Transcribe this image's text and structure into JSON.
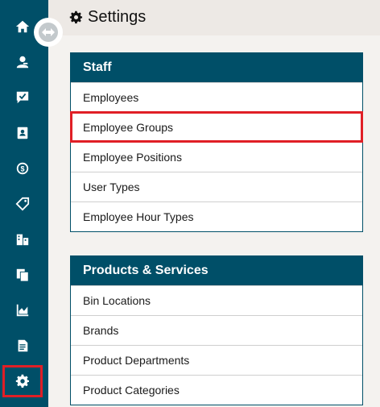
{
  "header": {
    "title": "Settings",
    "icon": "gear-icon"
  },
  "sidebar": {
    "items": [
      {
        "name": "home",
        "icon": "home-icon"
      },
      {
        "name": "customers",
        "icon": "user-icon"
      },
      {
        "name": "messages",
        "icon": "chat-check-icon"
      },
      {
        "name": "contacts",
        "icon": "contact-card-icon"
      },
      {
        "name": "billing",
        "icon": "dollar-circle-icon"
      },
      {
        "name": "pricing",
        "icon": "tag-icon"
      },
      {
        "name": "locations",
        "icon": "building-icon"
      },
      {
        "name": "documents",
        "icon": "copy-icon"
      },
      {
        "name": "reports",
        "icon": "chart-icon"
      },
      {
        "name": "notes",
        "icon": "file-text-icon"
      },
      {
        "name": "settings",
        "icon": "gear-icon",
        "selected": true
      }
    ]
  },
  "staff": {
    "title": "Staff",
    "items": [
      {
        "label": "Employees"
      },
      {
        "label": "Employee Groups",
        "highlighted": true
      },
      {
        "label": "Employee Positions"
      },
      {
        "label": "User Types"
      },
      {
        "label": "Employee Hour Types"
      }
    ]
  },
  "products": {
    "title": "Products & Services",
    "items": [
      {
        "label": "Bin Locations"
      },
      {
        "label": "Brands"
      },
      {
        "label": "Product Departments"
      },
      {
        "label": "Product Categories"
      }
    ]
  },
  "colors": {
    "sidebar": "#004f68",
    "panel_header": "#004f68",
    "highlight": "#e01f26",
    "background": "#f4f2ef"
  }
}
